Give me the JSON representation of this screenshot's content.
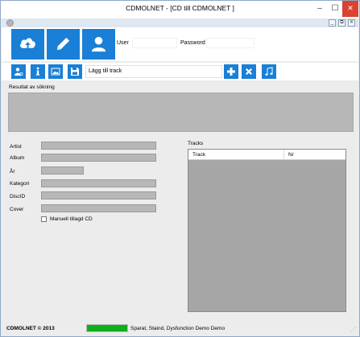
{
  "window": {
    "title": "CDMOLNET - [CD till CDMOLNET ]",
    "min_glyph": "–",
    "max_glyph": "☐",
    "close_glyph": "✕",
    "mdi_min_glyph": "_",
    "mdi_restore_glyph": "⧉",
    "mdi_close_glyph": "✕"
  },
  "top_panel": {
    "buttons": [
      {
        "name": "cloud-upload",
        "icon": "cloud-upload-icon"
      },
      {
        "name": "edit",
        "icon": "pencil-icon"
      },
      {
        "name": "user",
        "icon": "user-icon"
      }
    ],
    "user_label": "User",
    "user_value": "",
    "password_label": "Password",
    "password_value": ""
  },
  "toolbar": {
    "left_buttons": [
      {
        "name": "person-search",
        "icon": "person-search-icon"
      },
      {
        "name": "info",
        "icon": "info-icon"
      },
      {
        "name": "image",
        "icon": "image-icon"
      },
      {
        "name": "save",
        "icon": "save-icon"
      }
    ],
    "track_input_value": "Lägg till track",
    "right_buttons": [
      {
        "name": "add",
        "icon": "plus-icon"
      },
      {
        "name": "remove",
        "icon": "close-icon"
      },
      {
        "name": "music",
        "icon": "music-note-icon"
      }
    ]
  },
  "results": {
    "label": "Resultat av sökning"
  },
  "fields": [
    {
      "label": "Artist",
      "value": ""
    },
    {
      "label": "Album",
      "value": ""
    },
    {
      "label": "År",
      "value": ""
    },
    {
      "label": "Kategori",
      "value": ""
    },
    {
      "label": "DiscID",
      "value": ""
    },
    {
      "label": "Cover",
      "value": ""
    }
  ],
  "manual_checkbox": {
    "label": "Manuell tillagd CD",
    "checked": false
  },
  "tracks": {
    "label": "Tracks",
    "columns": [
      "Track",
      "Nr"
    ],
    "rows": []
  },
  "statusbar": {
    "brand": "CDMOLNET © 2013",
    "progress": 1.0,
    "text": "Sparat, Staind, Dysfunction  Demo Demo"
  },
  "colors": {
    "accent": "#1a7fd6",
    "progress": "#0fae1c",
    "field_bg": "#b7b7b7",
    "grid_bg": "#a6a6a6"
  }
}
